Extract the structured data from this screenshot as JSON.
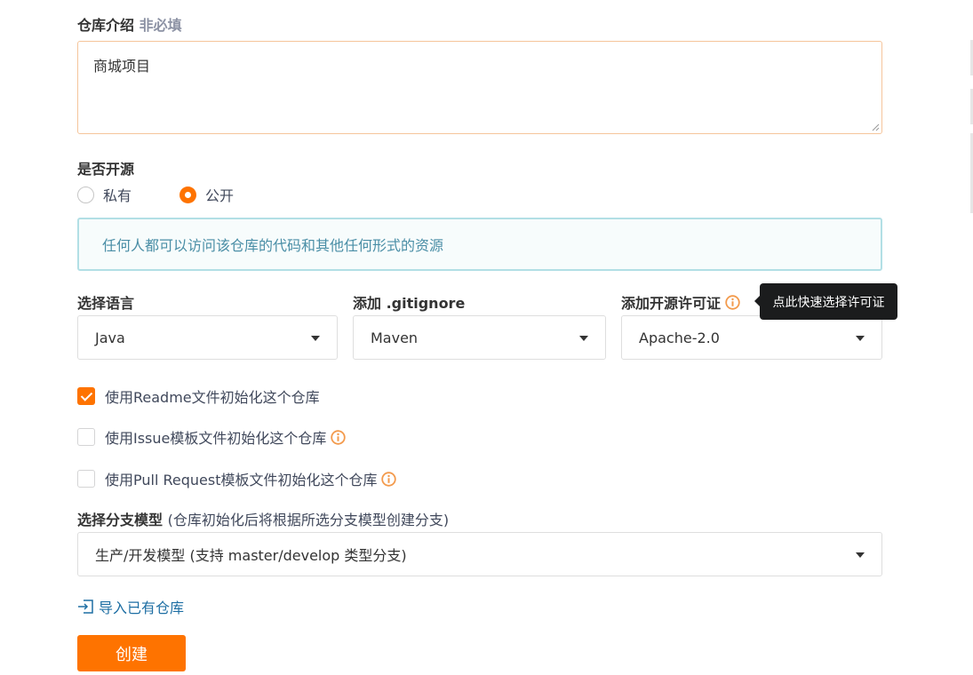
{
  "description_section": {
    "label": "仓库介绍",
    "optional_label": "非必填",
    "value": "商城项目"
  },
  "open_source_section": {
    "label": "是否开源",
    "options": [
      {
        "label": "私有",
        "checked": false
      },
      {
        "label": "公开",
        "checked": true
      }
    ],
    "info_text": "任何人都可以访问该仓库的代码和其他任何形式的资源"
  },
  "language": {
    "label": "选择语言",
    "selected": "Java"
  },
  "gitignore": {
    "label": "添加 .gitignore",
    "selected": "Maven"
  },
  "license": {
    "label": "添加开源许可证",
    "selected": "Apache-2.0",
    "tooltip": "点此快速选择许可证"
  },
  "init_options": [
    {
      "label": "使用Readme文件初始化这个仓库",
      "checked": true,
      "info_icon": false
    },
    {
      "label": "使用Issue模板文件初始化这个仓库",
      "checked": false,
      "info_icon": true
    },
    {
      "label": "使用Pull Request模板文件初始化这个仓库",
      "checked": false,
      "info_icon": true
    }
  ],
  "branch_model": {
    "label": "选择分支模型",
    "hint": "(仓库初始化后将根据所选分支模型创建分支)",
    "selected": "生产/开发模型 (支持 master/develop 类型分支)"
  },
  "import_link": {
    "label": "导入已有仓库",
    "icon": "import-icon"
  },
  "create_button": {
    "label": "创建"
  },
  "colors": {
    "accent": "#fe7300",
    "info_border": "#b2dfe5",
    "info_text": "#4a8ea6",
    "link": "#1d6ea3",
    "tooltip_bg": "#1b1c1d"
  }
}
